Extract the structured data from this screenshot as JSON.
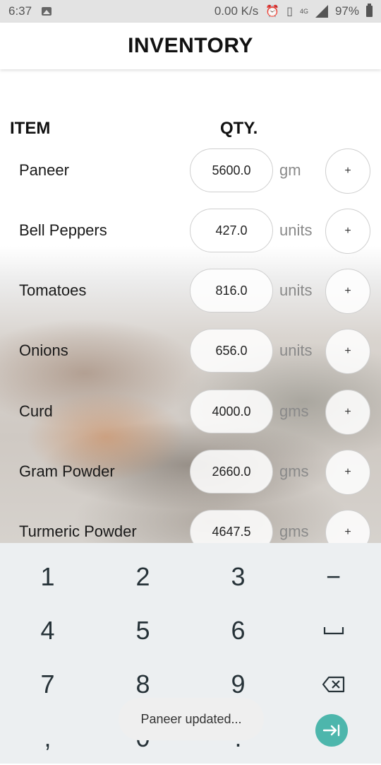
{
  "status_bar": {
    "time": "6:37",
    "net_speed": "0.00 K/s",
    "network_label": "4G",
    "battery": "97%"
  },
  "app_bar": {
    "title": "INVENTORY"
  },
  "table": {
    "col_item": "ITEM",
    "col_qty": "QTY.",
    "rows": [
      {
        "name": "Paneer",
        "qty": "5600.0",
        "unit": "gm",
        "add": "+"
      },
      {
        "name": "Bell Peppers",
        "qty": "427.0",
        "unit": "units",
        "add": "+"
      },
      {
        "name": "Tomatoes",
        "qty": "816.0",
        "unit": "units",
        "add": "+"
      },
      {
        "name": "Onions",
        "qty": "656.0",
        "unit": "units",
        "add": "+"
      },
      {
        "name": "Curd",
        "qty": "4000.0",
        "unit": "gms",
        "add": "+"
      },
      {
        "name": "Gram Powder",
        "qty": "2660.0",
        "unit": "gms",
        "add": "+"
      },
      {
        "name": "Turmeric Powder",
        "qty": "4647.5",
        "unit": "gms",
        "add": "+"
      }
    ]
  },
  "keyboard": {
    "k1": "1",
    "k2": "2",
    "k3": "3",
    "k_minus": "−",
    "k4": "4",
    "k5": "5",
    "k6": "6",
    "k7": "7",
    "k8": "8",
    "k9": "9",
    "k_comma": ",",
    "k0": "0",
    "k_dot": "."
  },
  "toast": {
    "message": "Paneer updated..."
  },
  "colors": {
    "accent": "#4db6ac",
    "keyboard_bg": "#eceff1"
  }
}
